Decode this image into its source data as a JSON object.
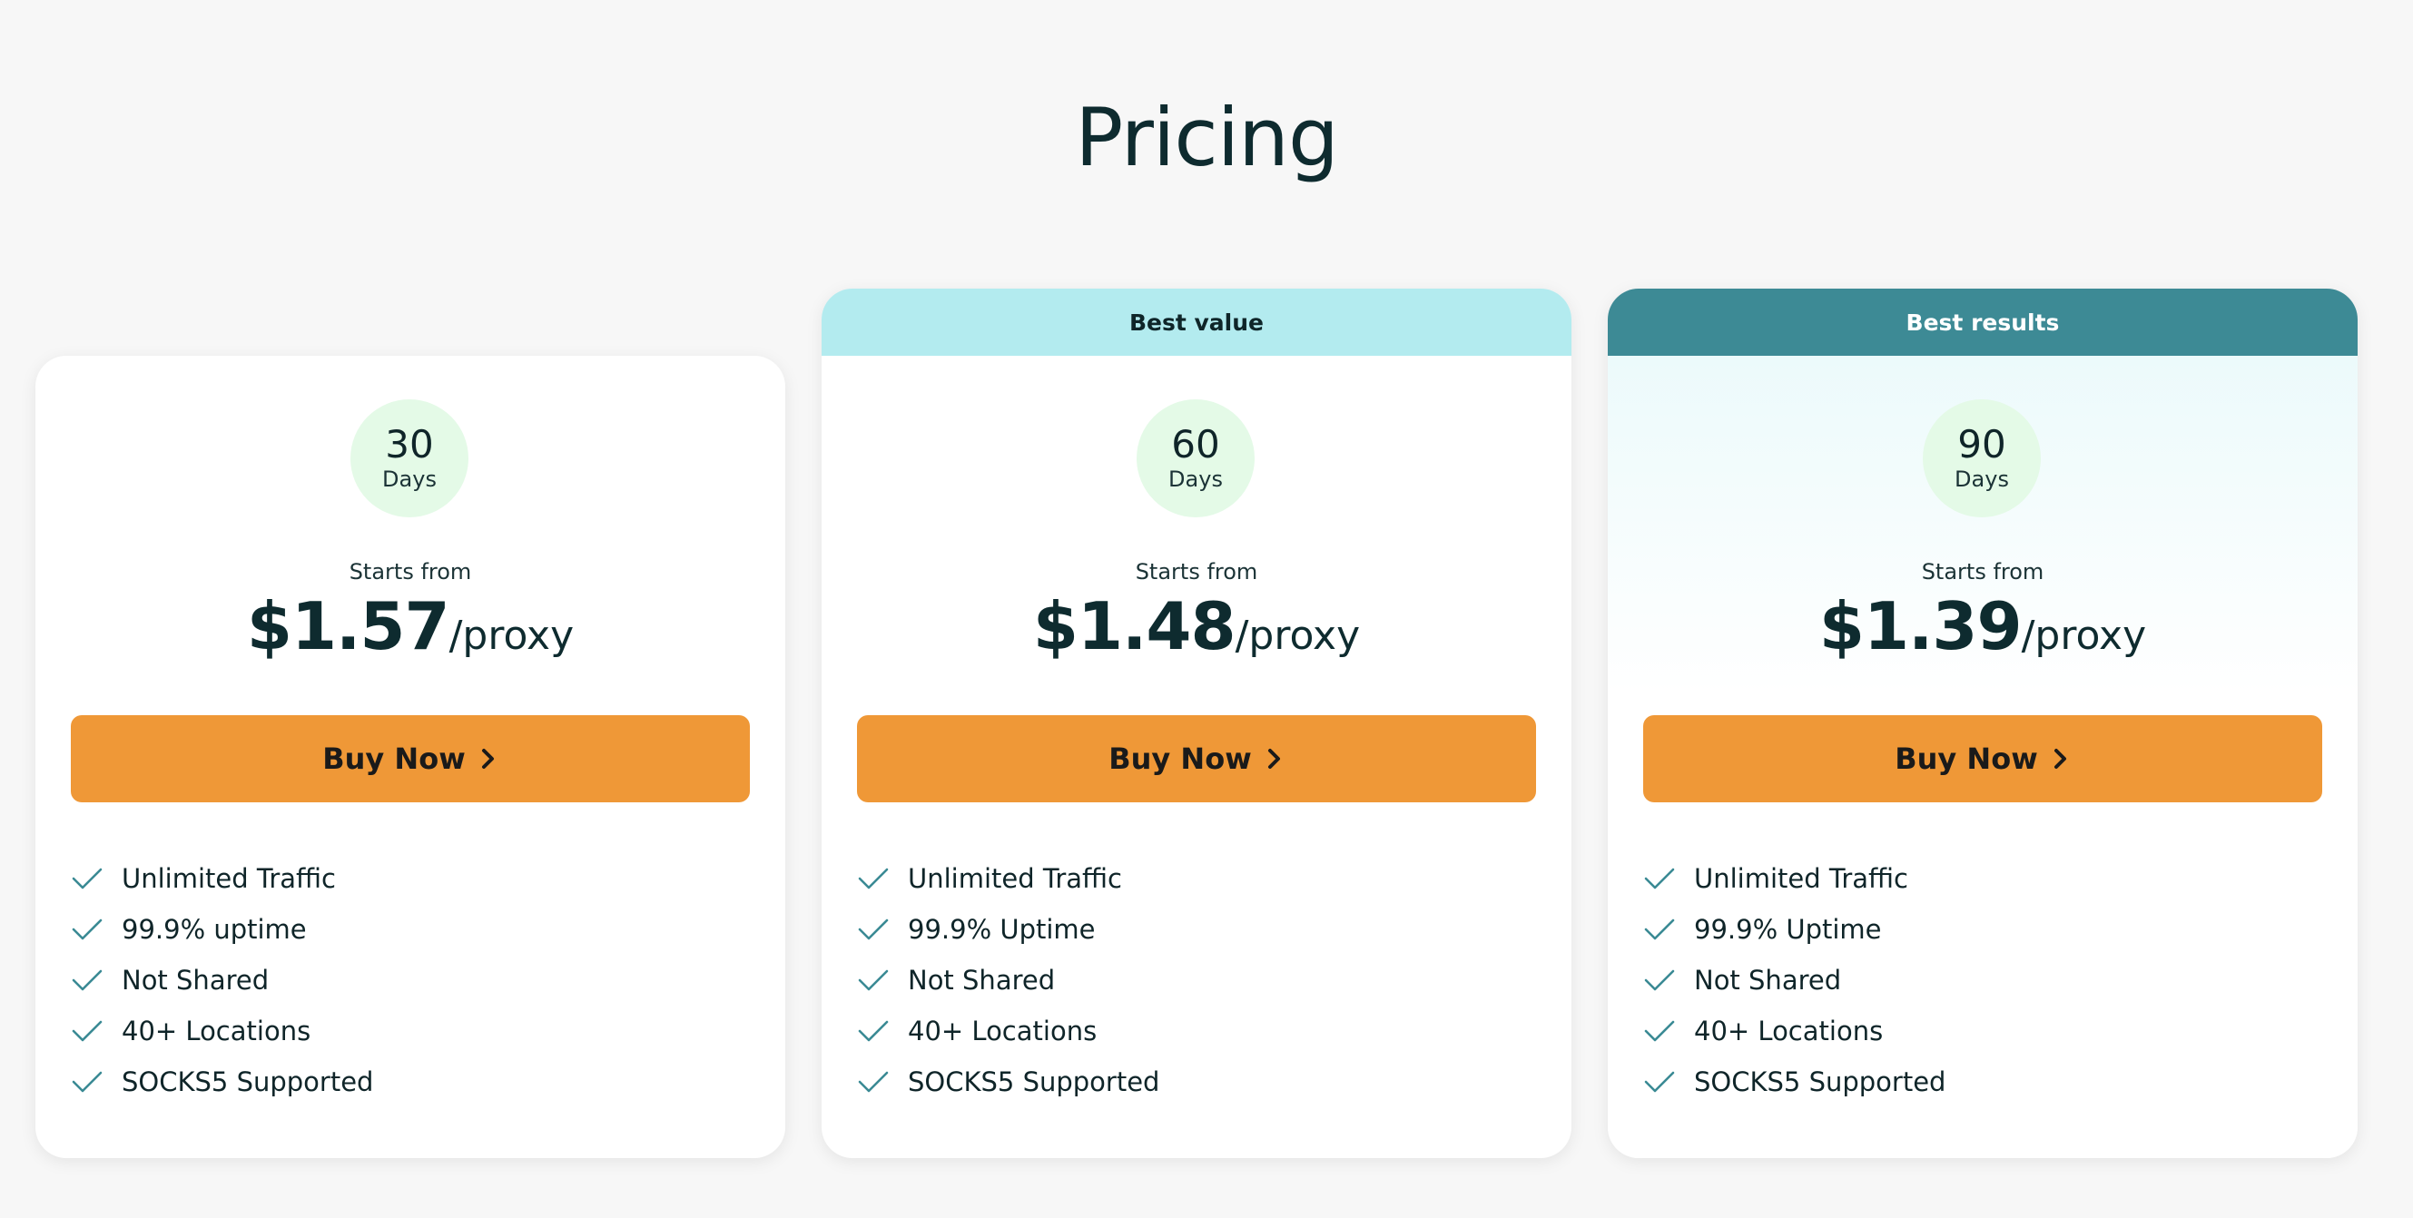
{
  "page": {
    "title": "Pricing"
  },
  "colors": {
    "background": "#f7f7f7",
    "button": "#ef9837",
    "best_value_ribbon": "#b3ebef",
    "best_results_ribbon": "#3d8a95",
    "days_circle": "#e4fae7",
    "check": "#3a8a94"
  },
  "plans": [
    {
      "ribbon": "",
      "days": "30",
      "days_unit": "Days",
      "starts_from": "Starts from",
      "price": "$1.57",
      "price_unit": "/proxy",
      "button_label": "Buy Now",
      "button_icon": "chevron-right-icon",
      "features": [
        "Unlimited Traffic",
        "99.9% uptime",
        "Not Shared",
        "40+ Locations",
        "SOCKS5 Supported"
      ]
    },
    {
      "ribbon": "Best value",
      "days": "60",
      "days_unit": "Days",
      "starts_from": "Starts from",
      "price": "$1.48",
      "price_unit": "/proxy",
      "button_label": "Buy Now",
      "button_icon": "chevron-right-icon",
      "features": [
        "Unlimited Traffic",
        "99.9% Uptime",
        "Not Shared",
        "40+ Locations",
        "SOCKS5 Supported"
      ]
    },
    {
      "ribbon": "Best results",
      "days": "90",
      "days_unit": "Days",
      "starts_from": "Starts from",
      "price": "$1.39",
      "price_unit": "/proxy",
      "button_label": "Buy Now",
      "button_icon": "chevron-right-icon",
      "features": [
        "Unlimited Traffic",
        "99.9% Uptime",
        "Not Shared",
        "40+ Locations",
        "SOCKS5 Supported"
      ]
    }
  ],
  "feature_icon": "check-icon"
}
